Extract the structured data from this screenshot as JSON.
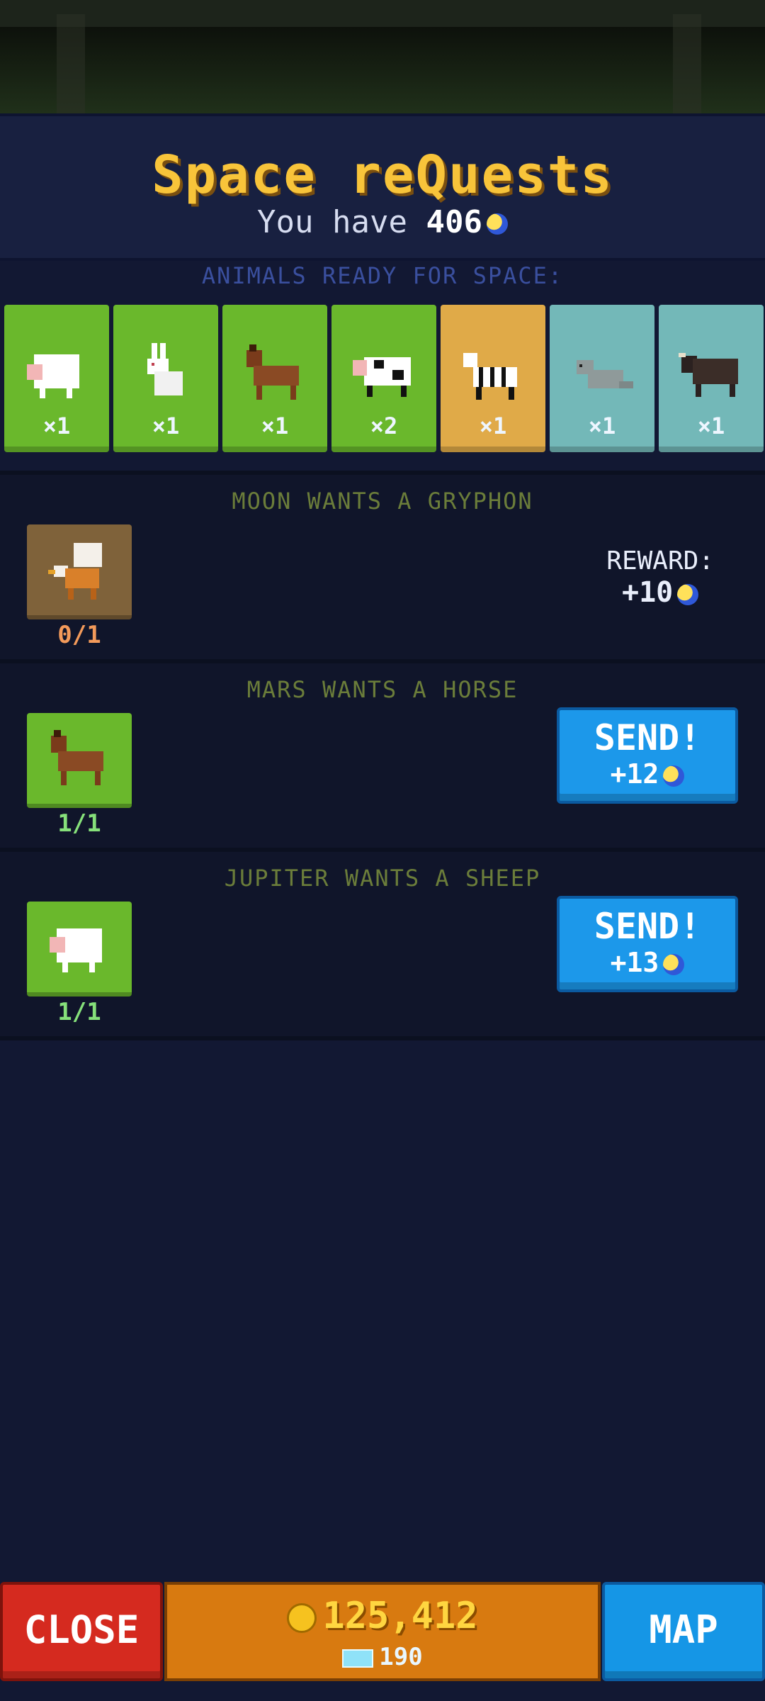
{
  "header": {
    "title": "Space reQuests",
    "have_prefix": "You have",
    "have_amount": "406",
    "currency_icon": "moon-coin-icon"
  },
  "ready_section": {
    "label": "ANIMALS READY FOR SPACE:",
    "animals": [
      {
        "name": "sheep",
        "count": "×1",
        "tile": "green"
      },
      {
        "name": "rabbit",
        "count": "×1",
        "tile": "green"
      },
      {
        "name": "horse",
        "count": "×1",
        "tile": "green"
      },
      {
        "name": "cow",
        "count": "×2",
        "tile": "green"
      },
      {
        "name": "zebra",
        "count": "×1",
        "tile": "gold"
      },
      {
        "name": "seal",
        "count": "×1",
        "tile": "teal"
      },
      {
        "name": "yak",
        "count": "×1",
        "tile": "teal"
      }
    ]
  },
  "requests": [
    {
      "title": "MOON WANTS A GRYPHON",
      "animal": "gryphon",
      "progress": "0/1",
      "reward_label": "REWARD:",
      "reward": "+10"
    },
    {
      "title": "MARS WANTS A HORSE",
      "animal": "horse",
      "progress": "1/1",
      "button": "SEND!",
      "reward": "+12"
    },
    {
      "title": "JUPITER WANTS A SHEEP",
      "animal": "sheep",
      "progress": "1/1",
      "button": "SEND!",
      "reward": "+13"
    }
  ],
  "bottom": {
    "close_label": "CLOSE",
    "coins": "125,412",
    "gems": "190",
    "map_label": "MAP"
  },
  "colors": {
    "title": "#f8c43a",
    "send_button": "#1c98ea",
    "close_button": "#d52a1f",
    "map_button": "#1596e6",
    "wallet": "#d87a10"
  }
}
